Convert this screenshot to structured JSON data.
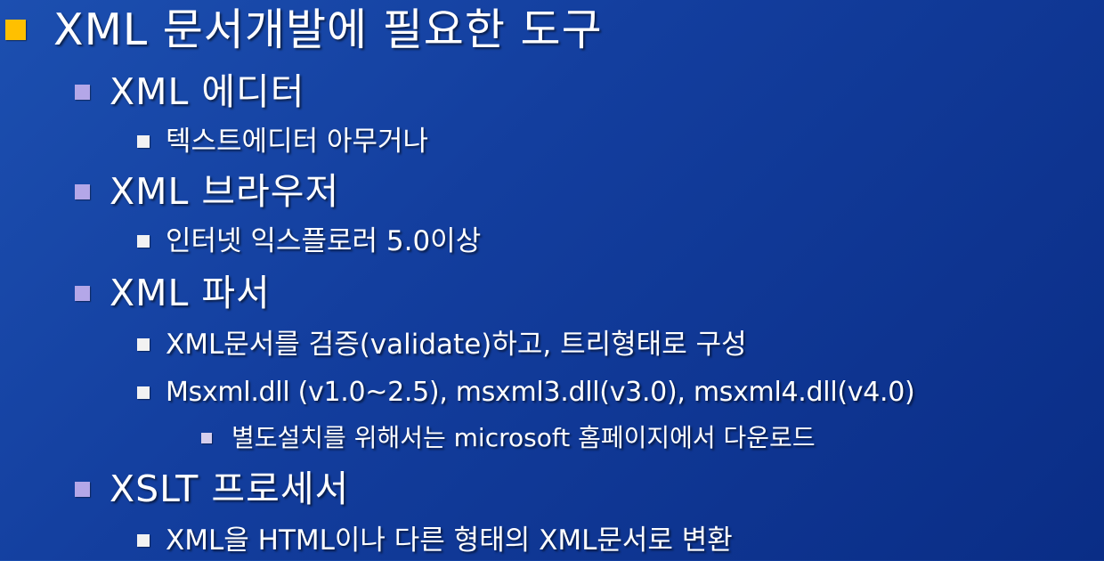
{
  "colors": {
    "level1_bullet": "#ffc000",
    "level2_bullet": "#b4a7e8",
    "level3_bullet": "#f2f2f2",
    "level4_bullet": "#d6cfee"
  },
  "outline": {
    "heading": "XML 문서개발에 필요한 도구",
    "editor": {
      "title": "XML 에디터",
      "detail": "텍스트에디터 아무거나"
    },
    "browser": {
      "title": "XML 브라우저",
      "detail": "인터넷 익스플로러 5.0이상"
    },
    "parser": {
      "title": "XML 파서",
      "detail_validate": "XML문서를 검증(validate)하고, 트리형태로 구성",
      "detail_versions": "Msxml.dll (v1.0~2.5), msxml3.dll(v3.0), msxml4.dll(v4.0)",
      "install_note": "별도설치를 위해서는 microsoft 홈페이지에서 다운로드"
    },
    "xslt": {
      "title": "XSLT 프로세서",
      "detail": "XML을 HTML이나 다른 형태의 XML문서로 변환"
    }
  }
}
